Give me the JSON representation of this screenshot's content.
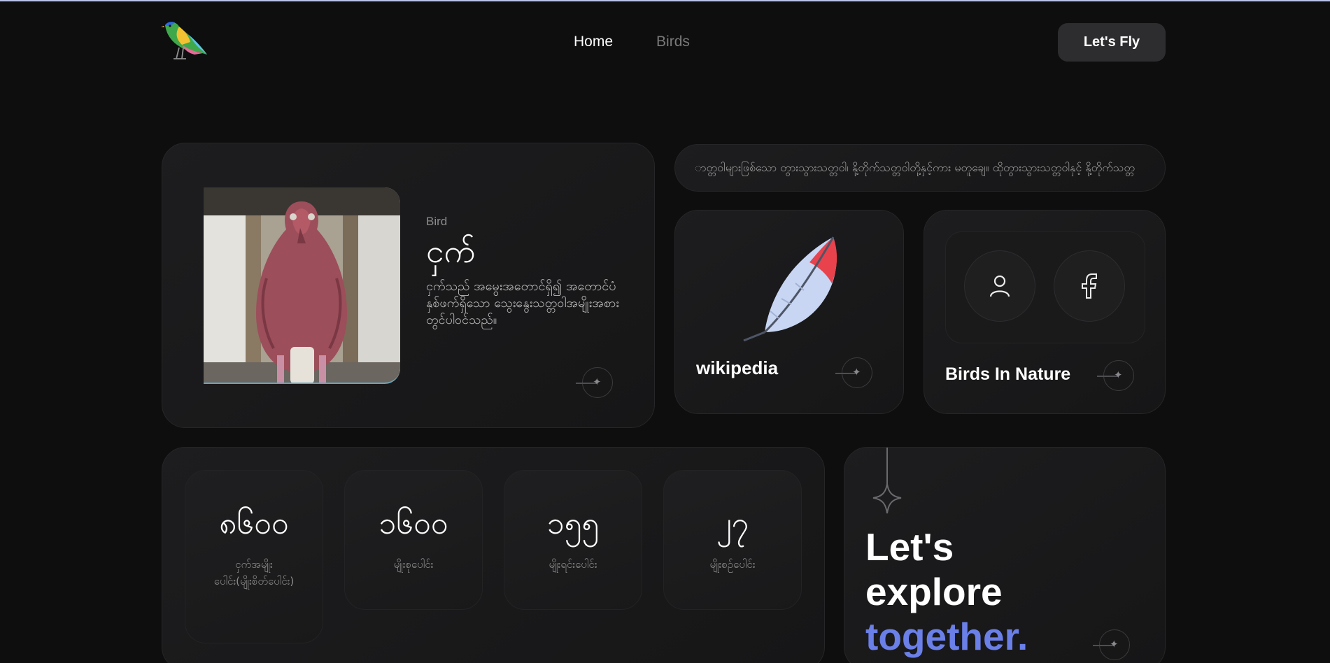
{
  "header": {
    "logo_icon": "bird-logo",
    "nav": [
      {
        "label": "Home",
        "active": true
      },
      {
        "label": "Birds",
        "active": false
      }
    ],
    "cta_label": "Let's Fly"
  },
  "hero": {
    "eyebrow": "Bird",
    "title": "ငှက်",
    "description": "ငှက်သည် အမွေးအတောင်ရှိ၍ အတောင်ပံ နှစ်ဖက်ရှိသော သွေးနွေးသတ္တဝါအမျိုးအစားတွင်ပါဝင်သည်။",
    "image_subject": "hintha-bird-statue"
  },
  "marquee": {
    "text": "ာတ္တဝါများဖြစ်သော တွားသွားသတ္တဝါ၊ နို့တိုက်သတ္တဝါတို့နှင့်ကား မတူချေ။ ထိုတွားသွားသတ္တဝါနှင့် နို့တိုက်သတ္တ"
  },
  "wiki": {
    "label": "wikipedia",
    "icon": "feather-icon"
  },
  "nature": {
    "label": "Birds In Nature",
    "buttons": [
      "user-icon",
      "facebook-icon"
    ]
  },
  "stats": [
    {
      "value": "၈၆၀၀",
      "caption": "ငှက်အမျိုးပေါင်း(မျိုးစိတ်ပေါင်း)"
    },
    {
      "value": "၁၆၀၀",
      "caption": "မျိုးစုပေါင်း"
    },
    {
      "value": "၁၅၅",
      "caption": "မျိုးရင်းပေါင်း"
    },
    {
      "value": "၂၇",
      "caption": "မျိုးစဉ်ပေါင်း"
    }
  ],
  "explore": {
    "line1": "Let's",
    "line2": "explore",
    "line3": "together.",
    "accent_color": "#6b7fe8"
  },
  "colors": {
    "background": "#0e0e0f",
    "card": "#1b1b1c",
    "feather_red": "#e8424d",
    "feather_blue": "#c8d6f3"
  }
}
